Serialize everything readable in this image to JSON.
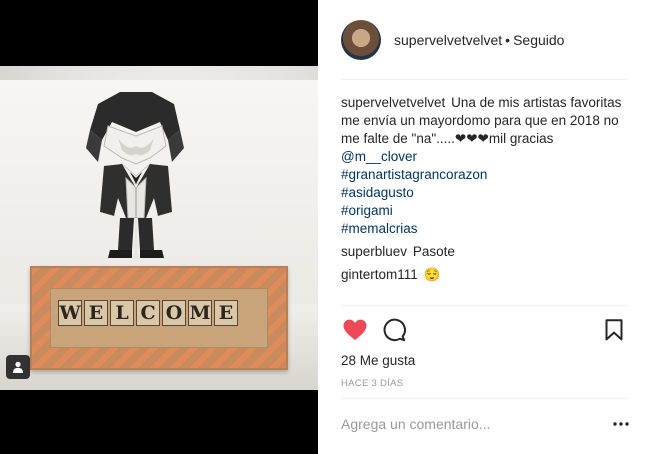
{
  "post": {
    "author": "supervelvetvelvet",
    "separator": "•",
    "follow_status": "Seguido",
    "caption_text": "Una de mis artistas favoritas me envía un mayordomo para que en 2018 no me falte de \"na\".....❤❤❤mil gracias",
    "caption_mention": "@m__clover",
    "hashtags": [
      "#granartistagrancorazon",
      "#asidagusto",
      "#origami",
      "#memalcrias"
    ],
    "comments": [
      {
        "user": "superbluev",
        "text": "Pasote"
      },
      {
        "user": "gintertom111",
        "text": "😌"
      }
    ],
    "likes_label": "28 Me gusta",
    "time_label": "HACE 3 DÍAS",
    "add_comment_placeholder": "Agrega un comentario...",
    "liked": true,
    "colors": {
      "like": "#ed4956",
      "link": "#003569"
    }
  },
  "photo": {
    "mat_letters": [
      "W",
      "E",
      "L",
      "C",
      "O",
      "M",
      "E"
    ]
  },
  "icons": {
    "like": "heart-icon",
    "comment": "comment-bubble-icon",
    "save": "bookmark-icon",
    "tag": "user-tag-icon",
    "more": "more-options-icon"
  }
}
